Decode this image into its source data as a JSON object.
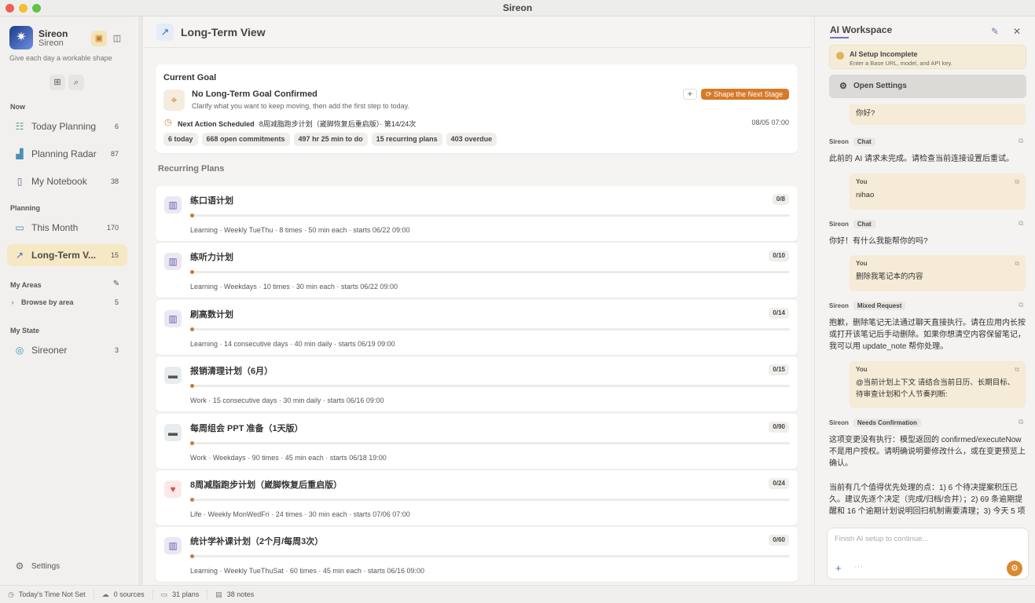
{
  "window": {
    "title": "Sireon"
  },
  "sidebar": {
    "app_name": "Sireon",
    "app_sub": "Sireon",
    "tagline": "Give each day a workable shape",
    "sections": {
      "now": "Now",
      "planning": "Planning",
      "areas": "My Areas",
      "state": "My State"
    },
    "now_items": [
      {
        "label": "Today Planning",
        "count": "6"
      },
      {
        "label": "Planning Radar",
        "count": "87"
      },
      {
        "label": "My Notebook",
        "count": "38"
      }
    ],
    "planning_items": [
      {
        "label": "This Month",
        "count": "170"
      },
      {
        "label": "Long-Term V...",
        "count": "15"
      }
    ],
    "areas_item": {
      "label": "Browse by area",
      "count": "5"
    },
    "state_item": {
      "label": "Sireoner",
      "count": "3"
    },
    "settings": "Settings"
  },
  "main": {
    "title": "Long-Term View",
    "goal": {
      "heading": "Current Goal",
      "title": "No Long-Term Goal Confirmed",
      "subtitle": "Clarify what you want to keep moving, then add the first step to today.",
      "shape_button": "Shape the Next Stage",
      "next_label": "Next Action Scheduled",
      "next_text": "8周减脂跑步计划（崴脚恢复后重启版）· 第14/24次",
      "next_date": "08/05 07:00",
      "chips": [
        "6 today",
        "668 open commitments",
        "497 hr 25 min to do",
        "15 recurring plans",
        "403 overdue"
      ]
    },
    "recurring_title": "Recurring Plans",
    "plans": [
      {
        "icon": "book",
        "title": "练口语计划",
        "count": "0/8",
        "progress": 0,
        "meta": "Learning · Weekly TueThu · 8 times · 50 min each · starts 06/22 09:00"
      },
      {
        "icon": "book",
        "title": "练听力计划",
        "count": "0/10",
        "progress": 0,
        "meta": "Learning · Weekdays · 10 times · 30 min each · starts 06/22 09:00"
      },
      {
        "icon": "book",
        "title": "刷高数计划",
        "count": "0/14",
        "progress": 0,
        "meta": "Learning · 14 consecutive days · 40 min daily · starts 06/19 09:00"
      },
      {
        "icon": "briefcase",
        "title": "报销清理计划（6月）",
        "count": "0/15",
        "progress": 0,
        "meta": "Work · 15 consecutive days · 30 min daily · starts 06/16 09:00"
      },
      {
        "icon": "briefcase",
        "title": "每周组会 PPT 准备（1天版）",
        "count": "0/90",
        "progress": 0,
        "meta": "Work · Weekdays · 90 times · 45 min each · starts 06/18 19:00"
      },
      {
        "icon": "heart",
        "title": "8周减脂跑步计划（崴脚恢复后重启版）",
        "count": "0/24",
        "progress": 0,
        "meta": "Life · Weekly MonWedFri · 24 times · 30 min each · starts 07/06 07:00"
      },
      {
        "icon": "book",
        "title": "统计学补课计划（2个月/每周3次）",
        "count": "0/60",
        "progress": 0,
        "meta": "Learning · Weekly TueThuSat · 60 times · 45 min each · starts 06/16 09:00"
      }
    ]
  },
  "panel": {
    "title": "AI Workspace",
    "setup_title": "AI Setup Incomplete",
    "setup_sub": "Enter a Base URL, model, and API key.",
    "open_settings": "Open Settings",
    "msg0": "你好?",
    "sender": "Sireon",
    "you": "You",
    "tag_chat": "Chat",
    "tag_mixed": "Mixed Request",
    "tag_confirm": "Needs Confirmation",
    "reply1": "此前的 AI 请求未完成。请检查当前连接设置后重试。",
    "user2": "nihao",
    "reply2": "你好！有什么我能帮你的吗?",
    "user3": "删除我笔记本的内容",
    "reply3": "抱歉，删除笔记无法通过聊天直接执行。请在应用内长按或打开该笔记后手动删除。如果你想清空内容保留笔记，我可以用 update_note 帮你处理。",
    "user4": "@当前计划上下文 请结合当前日历、长期目标、待审查计划和个人节奏判断:",
    "reply4a": "这项变更没有执行：模型返回的 confirmed/executeNow 不是用户授权。请明确说明要修改什么，或在变更预览上确认。",
    "reply4b": "当前有几个值得优先处理的点：1) 6 个待决提案积压已久。建议先逐个决定（完成/归档/合并）；2) 69 条逾期提醒和 16 个逾期计划说明回扫机制需要清理；3) 今天 5 项",
    "input_placeholder": "Finish AI setup to continue..."
  },
  "status": {
    "time": "Today's Time Not Set",
    "sources": "0 sources",
    "plans": "31 plans",
    "notes": "38 notes"
  },
  "colors": {
    "accent": "#d3772d",
    "active_nav": "#f6e8c4",
    "brand": "#2a4aa0"
  }
}
